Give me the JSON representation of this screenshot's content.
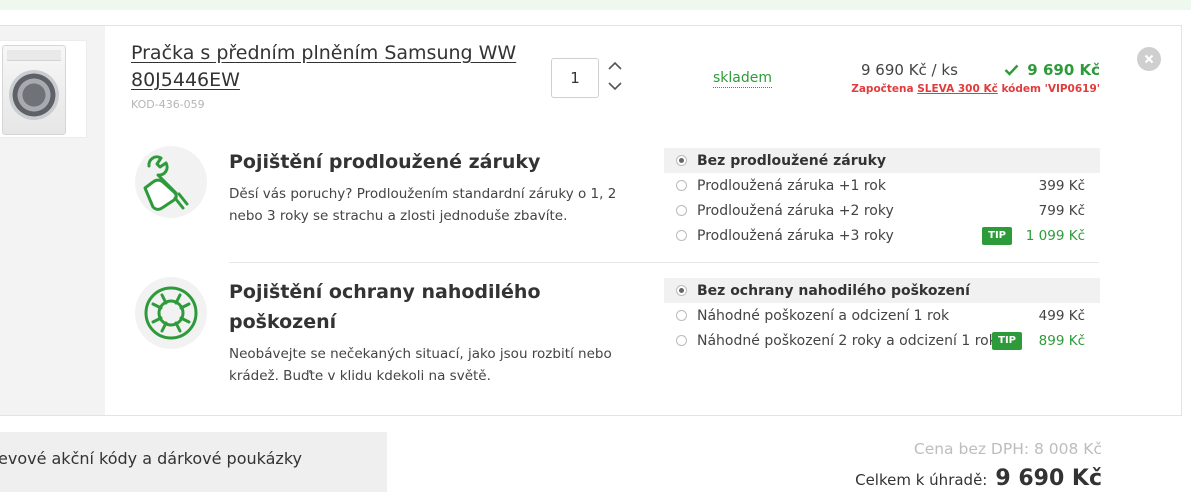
{
  "product": {
    "title": "Pračka s předním plněním Samsung WW 80J5446EW",
    "code": "KOD-436-059",
    "quantity": "1",
    "stock": "skladem",
    "unit_price": "9 690 Kč / ks",
    "total_price": "9 690 Kč",
    "discount_prefix": "Započtena ",
    "discount_link": "SLEVA 300 Kč",
    "discount_suffix": " kódem 'VIP0619'"
  },
  "warranty": {
    "title": "Pojištění prodloužené záruky",
    "description": "Děsí vás poruchy? Prodloužením standardní záruky o 1, 2 nebo 3 roky se strachu a zlosti jednoduše zbavíte.",
    "options": [
      {
        "label": "Bez prodloužené záruky",
        "price": "",
        "selected": true,
        "tip": false
      },
      {
        "label": "Prodloužená záruka +1 rok",
        "price": "399 Kč",
        "selected": false,
        "tip": false
      },
      {
        "label": "Prodloužená záruka +2 roky",
        "price": "799 Kč",
        "selected": false,
        "tip": false
      },
      {
        "label": "Prodloužená záruka +3 roky",
        "price": "1 099 Kč",
        "selected": false,
        "tip": true
      }
    ]
  },
  "damage": {
    "title": "Pojištění ochrany nahodilého poškození",
    "description": "Neobávejte se nečekaných situací, jako jsou rozbití nebo krádež. Buďte v klidu kdekoli na světě.",
    "options": [
      {
        "label": "Bez ochrany nahodilého poškození",
        "price": "",
        "selected": true,
        "tip": false
      },
      {
        "label": "Náhodné poškození a odcizení 1 rok",
        "price": "499 Kč",
        "selected": false,
        "tip": false
      },
      {
        "label": "Náhodné poškození 2 roky a odcizení 1 rok",
        "price": "899 Kč",
        "selected": false,
        "tip": true
      }
    ]
  },
  "tip_label": "TIP",
  "promo": {
    "text": "evové akční kódy a dárkové poukázky"
  },
  "summary": {
    "no_vat": "Cena bez DPH: 8 008 Kč",
    "total_label": "Celkem k úhradě:",
    "total": "9 690 Kč"
  },
  "colors": {
    "accent_green": "#2e9b3a",
    "discount_red": "#e23b3b"
  }
}
